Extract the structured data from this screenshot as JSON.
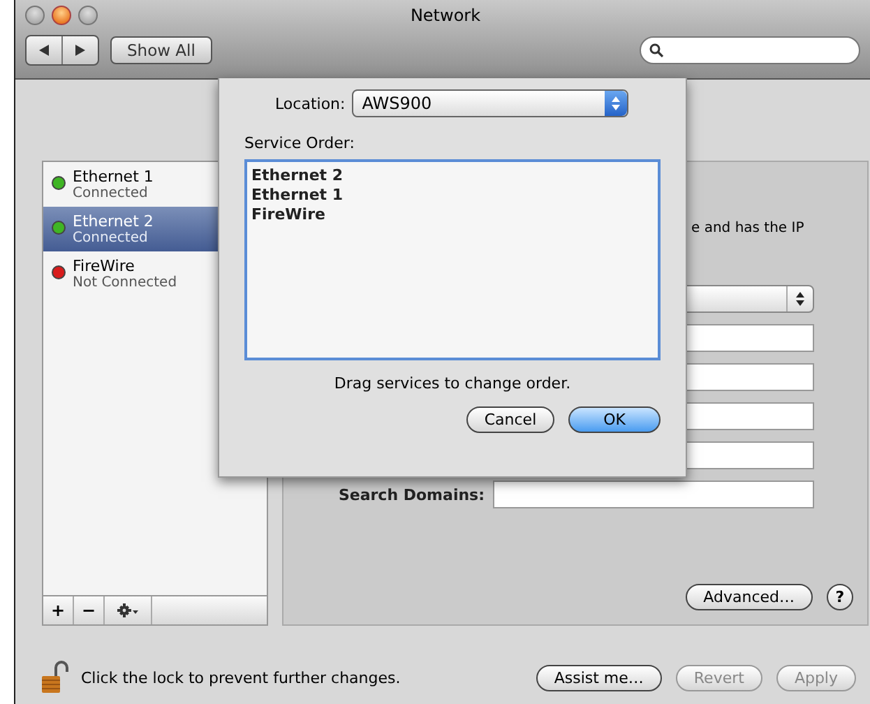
{
  "window": {
    "title": "Network"
  },
  "toolbar": {
    "show_all": "Show All"
  },
  "services": [
    {
      "name": "Ethernet 1",
      "status": "Connected",
      "color": "#3fb524",
      "selected": false
    },
    {
      "name": "Ethernet 2",
      "status": "Connected",
      "color": "#3fb524",
      "selected": true
    },
    {
      "name": "FireWire",
      "status": "Not Connected",
      "color": "#d81c1c",
      "selected": false
    }
  ],
  "list_buttons": [
    "+",
    "−"
  ],
  "panel": {
    "status_fragment": "e and has the IP",
    "search_domains_label": "Search Domains:",
    "advanced": "Advanced…",
    "help": "?"
  },
  "lock_text": "Click the lock to prevent further changes.",
  "bottom_buttons": [
    {
      "label": "Assist me…",
      "disabled": false
    },
    {
      "label": "Revert",
      "disabled": true
    },
    {
      "label": "Apply",
      "disabled": true
    }
  ],
  "sheet": {
    "location_label": "Location:",
    "location_value": "AWS900",
    "service_order_label": "Service Order:",
    "order": [
      "Ethernet 2",
      "Ethernet 1",
      "FireWire"
    ],
    "hint": "Drag services to change order.",
    "buttons": [
      {
        "label": "Cancel",
        "default": false
      },
      {
        "label": "OK",
        "default": true
      }
    ]
  }
}
